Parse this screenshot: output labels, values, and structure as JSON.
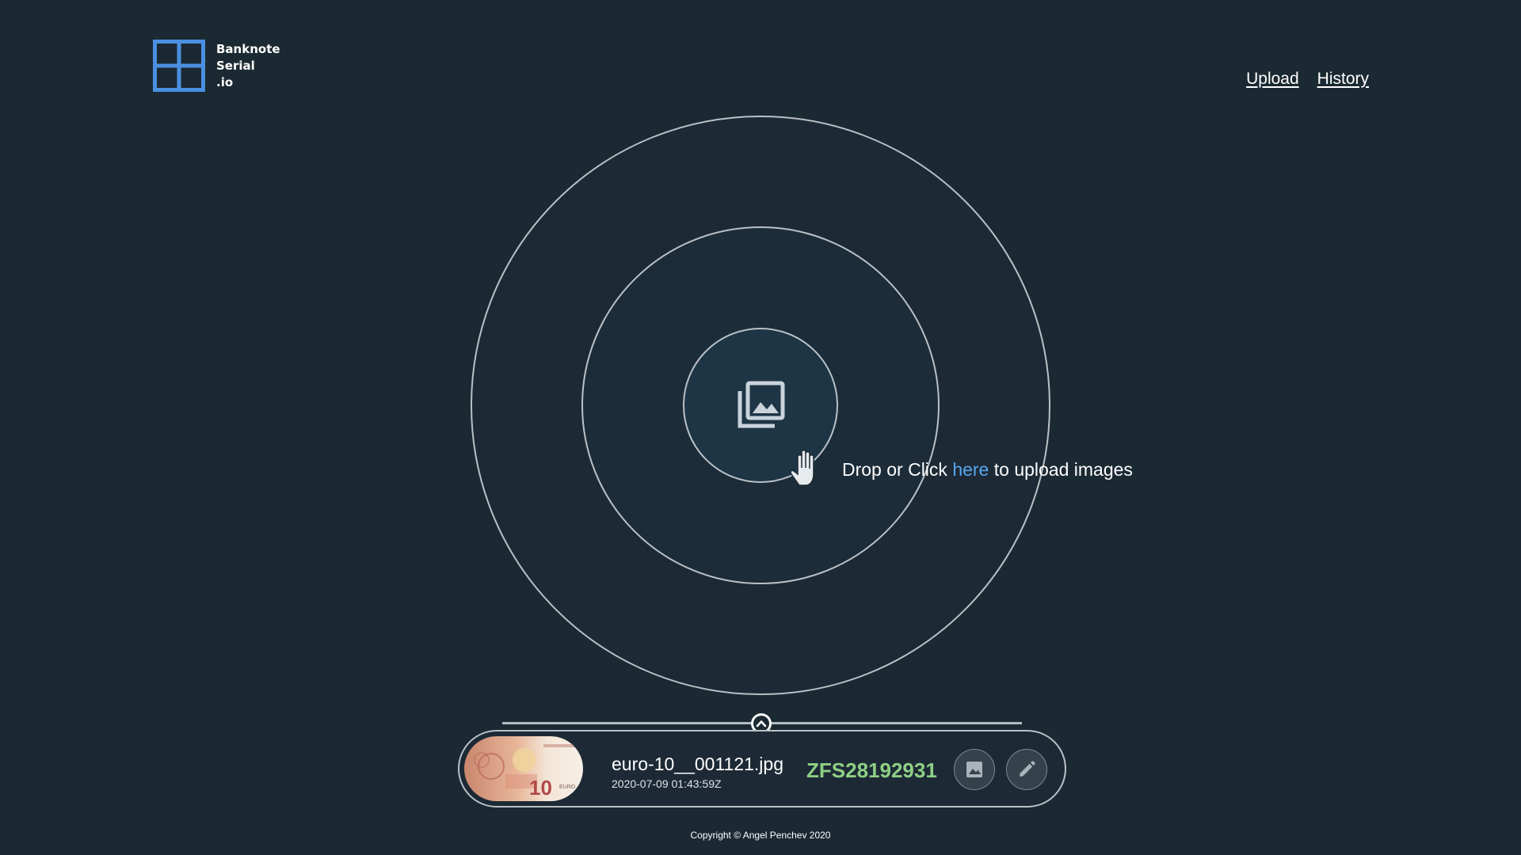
{
  "brand": {
    "lines": [
      "Banknote",
      "Serial",
      ".io"
    ],
    "color": "#4a90e2",
    "icon": "grid-logo-icon"
  },
  "nav": {
    "upload_label": "Upload",
    "history_label": "History"
  },
  "dropzone": {
    "text_before": "Drop or Click ",
    "link_label": "here",
    "text_after": " to upload images",
    "icon": "photo-library-icon",
    "hint_icon": "hand-pointer-icon"
  },
  "results": {
    "toggle_icon": "chevron-up-icon",
    "items": [
      {
        "file_name": "euro-10__001121.jpg",
        "timestamp": "2020-07-09 01:43:59Z",
        "serial": "ZFS28192931",
        "thumbnail_icon": "banknote-thumbnail"
      }
    ],
    "serial_color": "#8ecf84"
  },
  "footer": {
    "copyright": "Copyright © Angel Penchev 2020"
  }
}
